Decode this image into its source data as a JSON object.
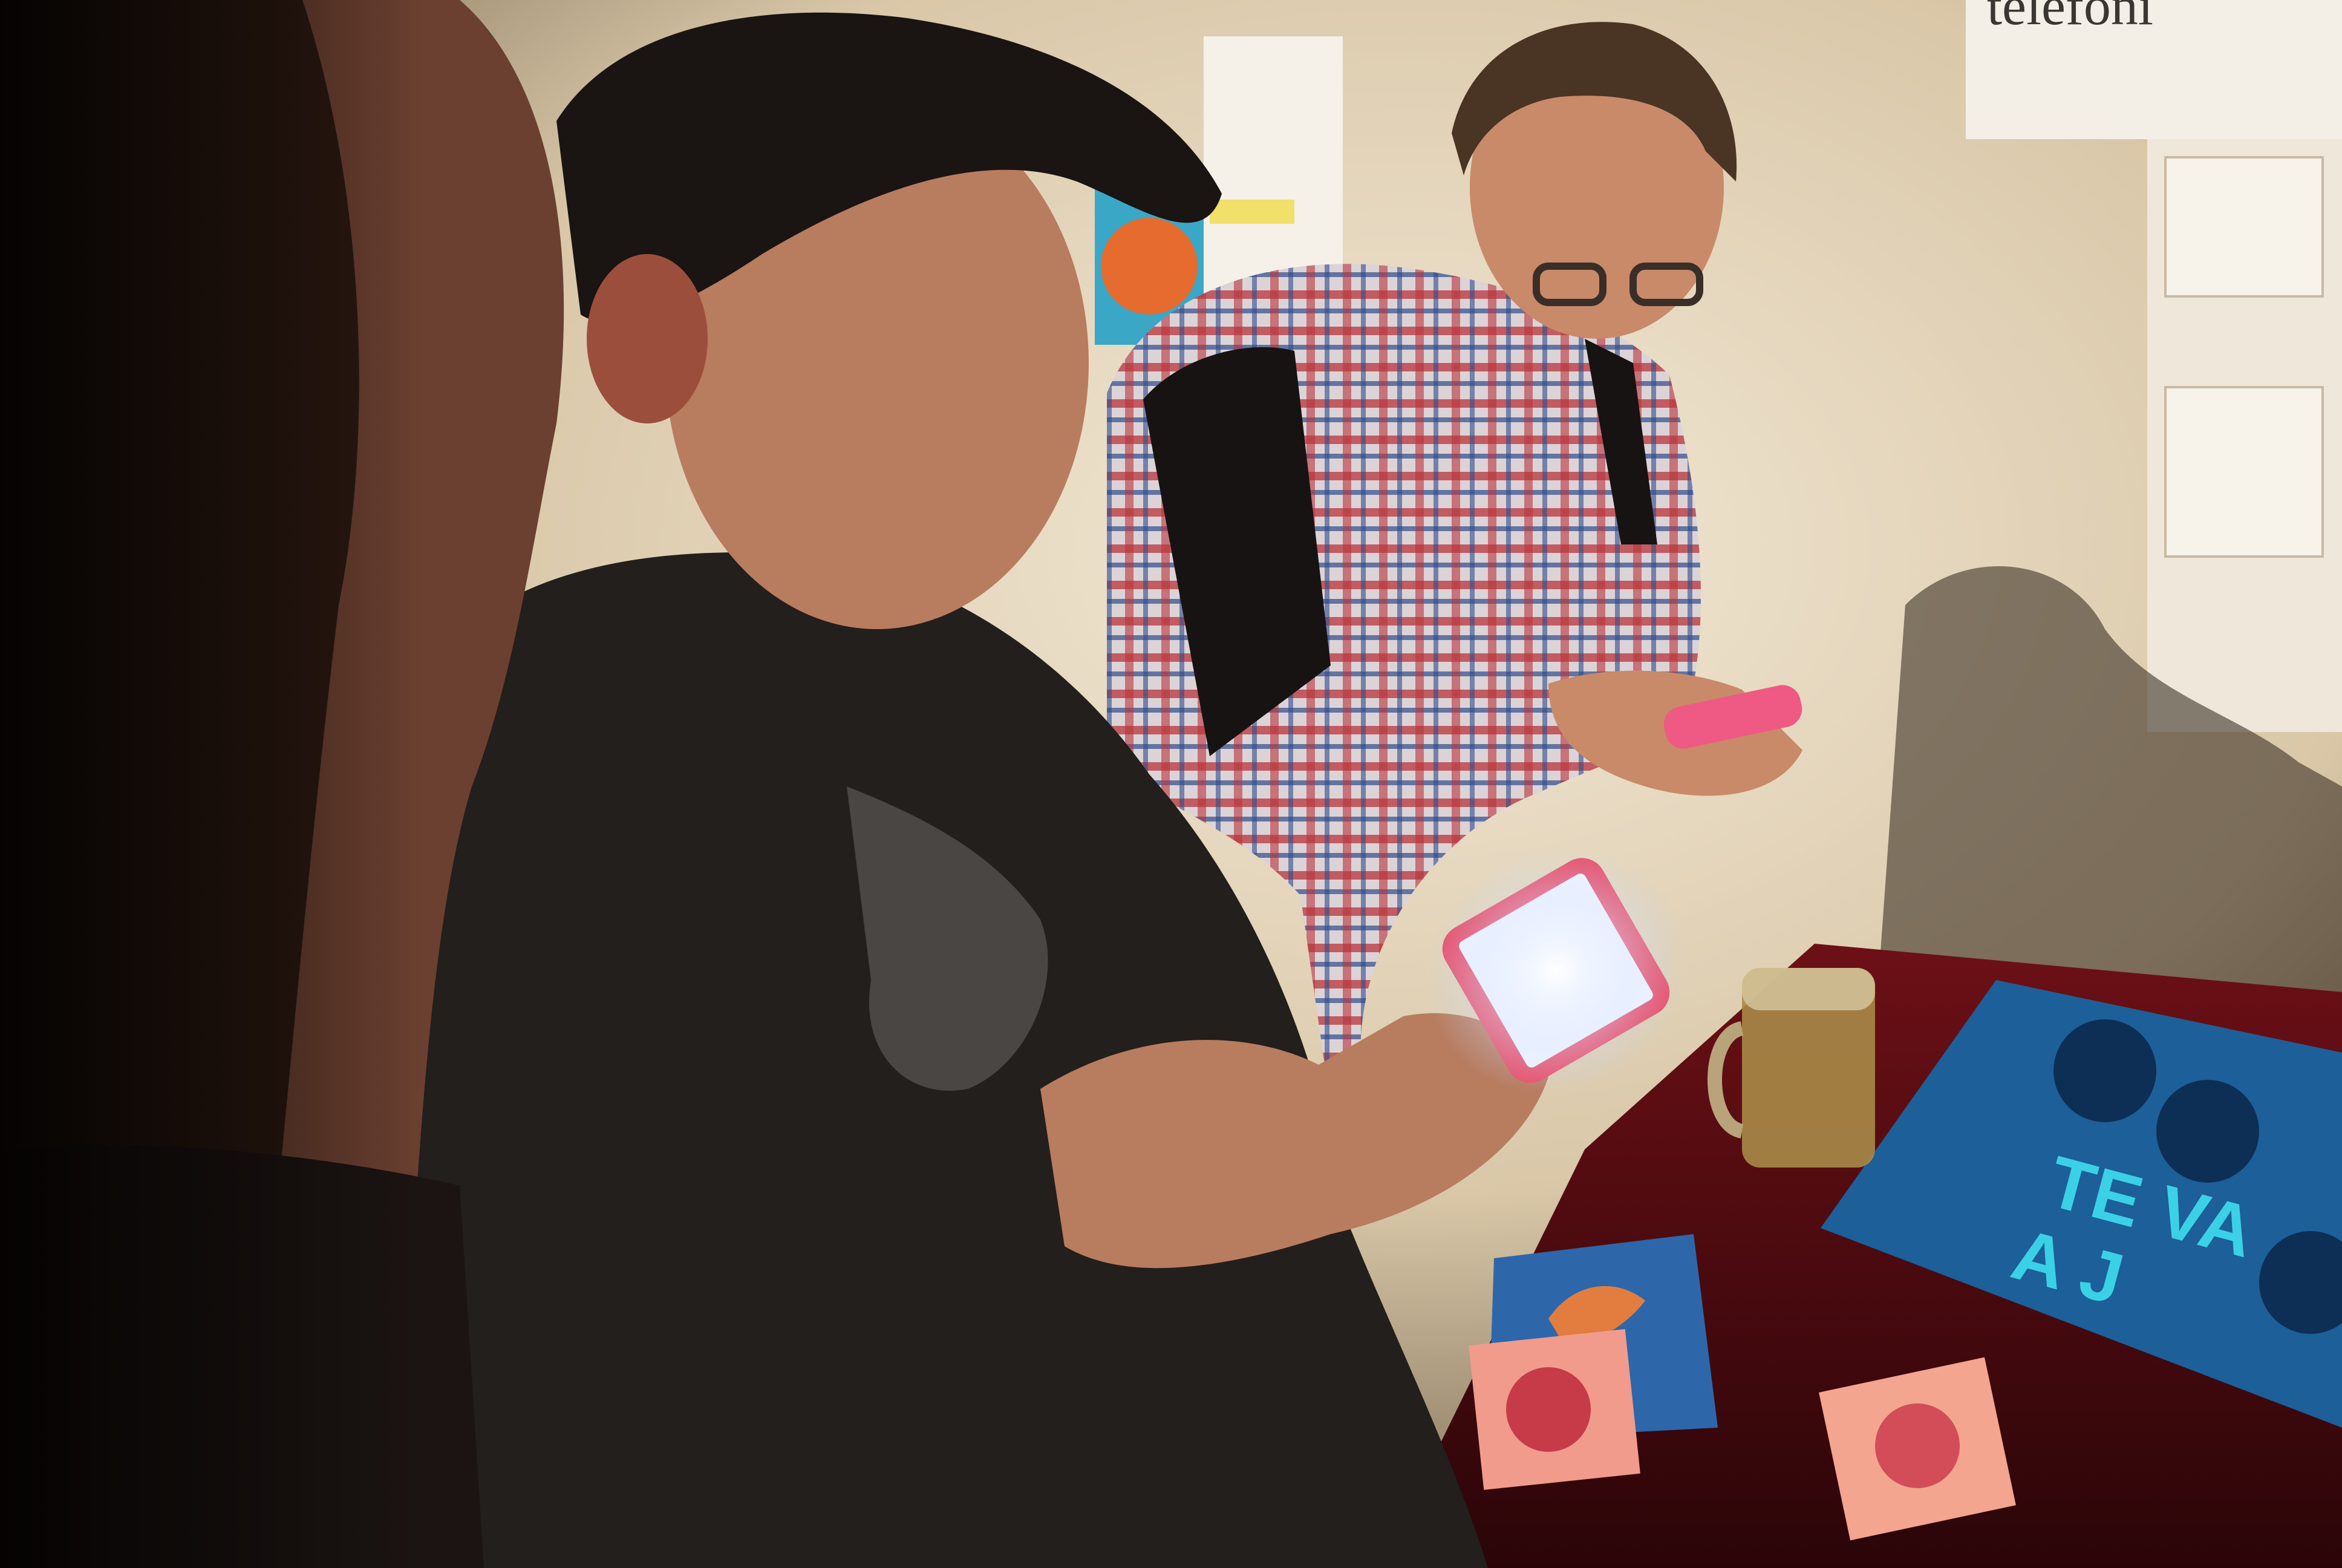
{
  "wall_sign": {
    "text": "telefoni"
  },
  "table_poster": {
    "line1": "TE VA",
    "line2": "A J"
  },
  "colors": {
    "wall": "#e9dcc4",
    "tablecloth": "#5a0c12",
    "poster_blue": "#1d5f98",
    "phone_case": "#e8506a",
    "screen_glow": "#f2f6ff"
  }
}
